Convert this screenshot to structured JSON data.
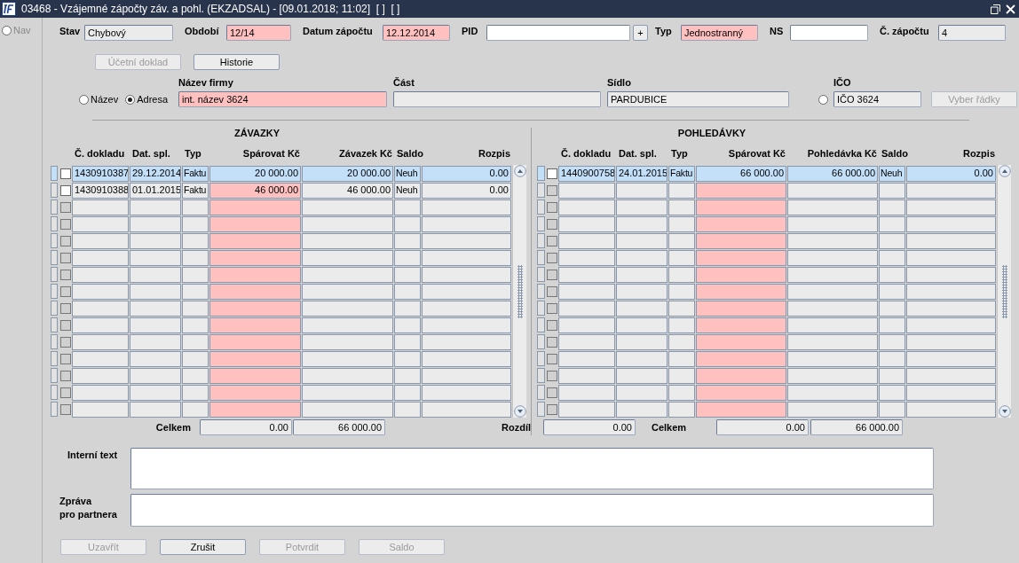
{
  "window": {
    "title": "03468 - Vzájemné zápočty záv. a pohl. (EKZADSAL) - [09.01.2018; 11:02]  [ ]  [ ]"
  },
  "sidebar": {
    "nav": {
      "label": "Nav",
      "disabled": true,
      "selected": false
    }
  },
  "header_fields": [
    {
      "label": "Stav",
      "value": "Chybový",
      "kind": "readonly"
    },
    {
      "label": "Období",
      "value": "12/14",
      "kind": "required"
    },
    {
      "label": "Datum zápočtu",
      "value": "12.12.2014",
      "kind": "required"
    },
    {
      "label": "PID",
      "kind": "editable",
      "button": "+"
    },
    {
      "label": "Typ",
      "value": "Jednostranný",
      "kind": "required"
    },
    {
      "label": "NS",
      "kind": "editable"
    },
    {
      "label": "Č. zápočtu",
      "value": "4",
      "kind": "readonly"
    }
  ],
  "actions": [
    {
      "label": "Účetní doklad",
      "disabled": true
    },
    {
      "label": "Historie",
      "disabled": false
    }
  ],
  "address": {
    "mode_options": [
      {
        "label": "Název",
        "selected": false
      },
      {
        "label": "Adresa",
        "selected": true
      }
    ],
    "fields": [
      {
        "label": "Název firmy",
        "value": "int. název 3624",
        "kind": "required"
      },
      {
        "label": "Část",
        "kind": "readonly"
      },
      {
        "label": "Sídlo",
        "value": "PARDUBICE",
        "kind": "readonly"
      },
      {
        "label": "IČO",
        "value": "IČO 3624",
        "kind": "readonly",
        "radio": {
          "selected": false
        }
      }
    ],
    "select_button": {
      "label": "Vyber řádky",
      "disabled": true
    }
  },
  "tables": [
    {
      "title": "ZÁVAZKY",
      "columns": [
        "Č. dokladu",
        "Dat. spl.",
        "Typ",
        "Spárovat Kč",
        "Závazek Kč",
        "Saldo",
        "Rozpis"
      ],
      "rows": [
        {
          "selected": true,
          "checked": false,
          "disabled": false,
          "cells": [
            "1430910387",
            "29.12.2014",
            "Faktu",
            "20 000.00",
            "20 000.00",
            "Neuh",
            "0.00"
          ]
        },
        {
          "selected": false,
          "checked": false,
          "disabled": false,
          "cells": [
            "1430910388",
            "01.01.2015",
            "Faktu",
            "46 000.00",
            "46 000.00",
            "Neuh",
            "0.00"
          ]
        },
        {
          "selected": false,
          "checked": false,
          "disabled": true
        },
        {
          "selected": false,
          "checked": false,
          "disabled": true
        },
        {
          "selected": false,
          "checked": false,
          "disabled": true
        },
        {
          "selected": false,
          "checked": false,
          "disabled": true
        },
        {
          "selected": false,
          "checked": false,
          "disabled": true
        },
        {
          "selected": false,
          "checked": false,
          "disabled": true
        },
        {
          "selected": false,
          "checked": false,
          "disabled": true
        },
        {
          "selected": false,
          "checked": false,
          "disabled": true
        },
        {
          "selected": false,
          "checked": false,
          "disabled": true
        },
        {
          "selected": false,
          "checked": false,
          "disabled": true
        },
        {
          "selected": false,
          "checked": false,
          "disabled": true
        },
        {
          "selected": false,
          "checked": false,
          "disabled": true
        },
        {
          "selected": false,
          "checked": false,
          "disabled": true
        }
      ],
      "totals_label": "Celkem",
      "totals": [
        "0.00",
        "66 000.00"
      ]
    },
    {
      "title": "POHLEDÁVKY",
      "columns": [
        "Č. dokladu",
        "Dat. spl.",
        "Typ",
        "Spárovat Kč",
        "Pohledávka Kč",
        "Saldo",
        "Rozpis"
      ],
      "rows": [
        {
          "selected": true,
          "checked": false,
          "disabled": false,
          "cells": [
            "1440900758",
            "24.01.2015",
            "Faktu",
            "66 000.00",
            "66 000.00",
            "Neuh",
            "0.00"
          ]
        },
        {
          "selected": false,
          "checked": false,
          "disabled": true
        },
        {
          "selected": false,
          "checked": false,
          "disabled": true
        },
        {
          "selected": false,
          "checked": false,
          "disabled": true
        },
        {
          "selected": false,
          "checked": false,
          "disabled": true
        },
        {
          "selected": false,
          "checked": false,
          "disabled": true
        },
        {
          "selected": false,
          "checked": false,
          "disabled": true
        },
        {
          "selected": false,
          "checked": false,
          "disabled": true
        },
        {
          "selected": false,
          "checked": false,
          "disabled": true
        },
        {
          "selected": false,
          "checked": false,
          "disabled": true
        },
        {
          "selected": false,
          "checked": false,
          "disabled": true
        },
        {
          "selected": false,
          "checked": false,
          "disabled": true
        },
        {
          "selected": false,
          "checked": false,
          "disabled": true
        },
        {
          "selected": false,
          "checked": false,
          "disabled": true
        },
        {
          "selected": false,
          "checked": false,
          "disabled": true
        }
      ],
      "difference": {
        "label": "Rozdíl",
        "value": "0.00"
      },
      "totals_label": "Celkem",
      "totals": [
        "0.00",
        "66 000.00"
      ]
    }
  ],
  "notes": [
    {
      "label": "Interní text"
    },
    {
      "label": "Zpráva\npro partnera"
    }
  ],
  "buttons": [
    {
      "label": "Uzavřít",
      "disabled": true
    },
    {
      "label": "Zrušit",
      "disabled": false
    },
    {
      "label": "Potvrdit",
      "disabled": true
    },
    {
      "label": "Saldo",
      "disabled": true
    }
  ]
}
